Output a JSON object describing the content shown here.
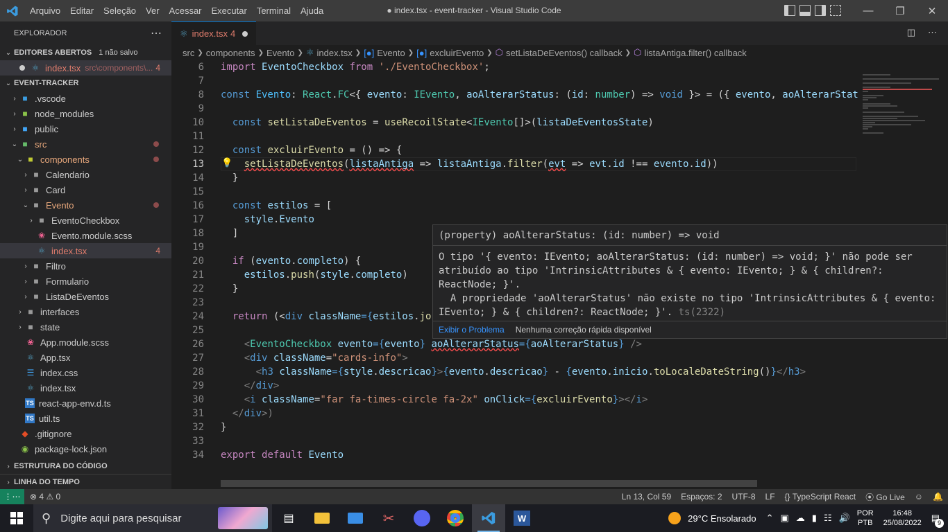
{
  "window": {
    "title": "● index.tsx - event-tracker - Visual Studio Code",
    "menu": [
      "Arquivo",
      "Editar",
      "Seleção",
      "Ver",
      "Acessar",
      "Executar",
      "Terminal",
      "Ajuda"
    ]
  },
  "sidebar": {
    "title": "EXPLORADOR",
    "open_editors": {
      "label": "EDITORES ABERTOS",
      "unsaved": "1 não salvo",
      "file": "index.tsx",
      "path": "src\\components\\...",
      "count": "4"
    },
    "project": "EVENT-TRACKER",
    "tree": [
      {
        "label": ".vscode",
        "depth": 1,
        "kind": "folder",
        "icon": "vscode-folder-icon",
        "chev": "›"
      },
      {
        "label": "node_modules",
        "depth": 1,
        "kind": "folder",
        "icon": "node-folder-icon",
        "chev": "›"
      },
      {
        "label": "public",
        "depth": 1,
        "kind": "folder",
        "icon": "public-folder-icon",
        "chev": "›"
      },
      {
        "label": "src",
        "depth": 1,
        "kind": "folder",
        "icon": "src-folder-icon",
        "chev": "⌄",
        "error": true,
        "dot": true
      },
      {
        "label": "components",
        "depth": 2,
        "kind": "folder",
        "icon": "components-folder-icon",
        "chev": "⌄",
        "error": true,
        "dot": true
      },
      {
        "label": "Calendario",
        "depth": 3,
        "kind": "folder",
        "icon": "folder-icon",
        "chev": "›"
      },
      {
        "label": "Card",
        "depth": 3,
        "kind": "folder",
        "icon": "folder-icon",
        "chev": "›"
      },
      {
        "label": "Evento",
        "depth": 3,
        "kind": "folder",
        "icon": "folder-open-icon",
        "chev": "⌄",
        "error": true,
        "dot": true
      },
      {
        "label": "EventoCheckbox",
        "depth": 4,
        "kind": "folder",
        "icon": "folder-icon",
        "chev": "›"
      },
      {
        "label": "Evento.module.scss",
        "depth": 4,
        "kind": "file",
        "icon": "scss-icon"
      },
      {
        "label": "index.tsx",
        "depth": 4,
        "kind": "file",
        "icon": "react-icon",
        "error": true,
        "selected": true,
        "count": "4"
      },
      {
        "label": "Filtro",
        "depth": 3,
        "kind": "folder",
        "icon": "folder-icon",
        "chev": "›"
      },
      {
        "label": "Formulario",
        "depth": 3,
        "kind": "folder",
        "icon": "folder-icon",
        "chev": "›"
      },
      {
        "label": "ListaDeEventos",
        "depth": 3,
        "kind": "folder",
        "icon": "folder-icon",
        "chev": "›"
      },
      {
        "label": "interfaces",
        "depth": 2,
        "kind": "folder",
        "icon": "folder-icon",
        "chev": "›"
      },
      {
        "label": "state",
        "depth": 2,
        "kind": "folder",
        "icon": "folder-icon",
        "chev": "›"
      },
      {
        "label": "App.module.scss",
        "depth": 2,
        "kind": "file",
        "icon": "scss-icon"
      },
      {
        "label": "App.tsx",
        "depth": 2,
        "kind": "file",
        "icon": "react-icon"
      },
      {
        "label": "index.css",
        "depth": 2,
        "kind": "file",
        "icon": "css-icon"
      },
      {
        "label": "index.tsx",
        "depth": 2,
        "kind": "file",
        "icon": "react-icon"
      },
      {
        "label": "react-app-env.d.ts",
        "depth": 2,
        "kind": "file",
        "icon": "ts-icon"
      },
      {
        "label": "util.ts",
        "depth": 2,
        "kind": "file",
        "icon": "ts-icon"
      },
      {
        "label": ".gitignore",
        "depth": 1,
        "kind": "file",
        "icon": "git-icon"
      },
      {
        "label": "package-lock.json",
        "depth": 1,
        "kind": "file",
        "icon": "json-icon"
      }
    ],
    "outline": "ESTRUTURA DO CÓDIGO",
    "timeline": "LINHA DO TEMPO"
  },
  "tab": {
    "label": "index.tsx",
    "problems": "4"
  },
  "breadcrumb": [
    "src",
    "components",
    "Evento",
    "index.tsx",
    "Evento",
    "excluirEvento",
    "setListaDeEventos() callback",
    "listaAntiga.filter() callback"
  ],
  "code": {
    "current_line": 13,
    "lines": [
      {
        "n": 6,
        "t": [
          [
            "import ",
            "kw"
          ],
          [
            "EventoCheckbox ",
            "vr"
          ],
          [
            "from ",
            "kw"
          ],
          [
            "'./EventoCheckbox'",
            "st"
          ],
          [
            ";",
            "pu"
          ]
        ]
      },
      {
        "n": 7,
        "t": []
      },
      {
        "n": 8,
        "t": [
          [
            "const ",
            "kb"
          ],
          [
            "Evento",
            "cy"
          ],
          [
            ": ",
            "pu"
          ],
          [
            "React",
            "ty"
          ],
          [
            ".",
            "pu"
          ],
          [
            "FC",
            "ty"
          ],
          [
            "<{ ",
            "pu"
          ],
          [
            "evento",
            "vr"
          ],
          [
            ": ",
            "pu"
          ],
          [
            "IEvento",
            "ty"
          ],
          [
            ", ",
            "pu"
          ],
          [
            "aoAlterarStatus",
            "vr"
          ],
          [
            ": (",
            "pu"
          ],
          [
            "id",
            "vr"
          ],
          [
            ": ",
            "pu"
          ],
          [
            "number",
            "ty"
          ],
          [
            ") => ",
            "pu"
          ],
          [
            "void",
            "kb"
          ],
          [
            " }> = ({ ",
            "pu"
          ],
          [
            "evento",
            "vr"
          ],
          [
            ", ",
            "pu"
          ],
          [
            "aoAlterarStat",
            "vr"
          ]
        ]
      },
      {
        "n": 9,
        "t": []
      },
      {
        "n": 10,
        "t": [
          [
            "  const ",
            "kb"
          ],
          [
            "setListaDeEventos",
            "fn"
          ],
          [
            " = ",
            "pu"
          ],
          [
            "useRecoilState",
            "fn"
          ],
          [
            "<",
            "pu"
          ],
          [
            "IEvento",
            "ty"
          ],
          [
            "[]",
            "pu"
          ],
          [
            ">(",
            "pu"
          ],
          [
            "listaDeEventosState",
            "vr"
          ],
          [
            ")",
            "pu"
          ]
        ]
      },
      {
        "n": 11,
        "t": []
      },
      {
        "n": 12,
        "t": [
          [
            "  const ",
            "kb"
          ],
          [
            "excluirEvento",
            "fn"
          ],
          [
            " = () => {",
            "pu"
          ]
        ]
      },
      {
        "n": 13,
        "t": [
          [
            "    ",
            "pu"
          ],
          [
            "setListaDeEventos",
            "fn",
            "sq"
          ],
          [
            "(",
            "pu"
          ],
          [
            "listaAntiga",
            "vr",
            "sq"
          ],
          [
            " => ",
            "pu"
          ],
          [
            "listaAntiga",
            "vr"
          ],
          [
            ".",
            "pu"
          ],
          [
            "filter",
            "fn"
          ],
          [
            "(",
            "pu"
          ],
          [
            "evt",
            "vr",
            "sq"
          ],
          [
            " => ",
            "pu"
          ],
          [
            "evt",
            "vr"
          ],
          [
            ".",
            "pu"
          ],
          [
            "id",
            "vr"
          ],
          [
            " !== ",
            "pu"
          ],
          [
            "evento",
            "vr"
          ],
          [
            ".",
            "pu"
          ],
          [
            "id",
            "vr"
          ],
          [
            "))",
            "pu"
          ]
        ]
      },
      {
        "n": 14,
        "t": [
          [
            "  }",
            "pu"
          ]
        ]
      },
      {
        "n": 15,
        "t": []
      },
      {
        "n": 16,
        "t": [
          [
            "  const ",
            "kb"
          ],
          [
            "estilos",
            "vr"
          ],
          [
            " = [",
            "pu"
          ]
        ]
      },
      {
        "n": 17,
        "t": [
          [
            "    ",
            "pu"
          ],
          [
            "style",
            "vr"
          ],
          [
            ".",
            "pu"
          ],
          [
            "Evento",
            "vr"
          ]
        ]
      },
      {
        "n": 18,
        "t": [
          [
            "  ]",
            "pu"
          ]
        ]
      },
      {
        "n": 19,
        "t": []
      },
      {
        "n": 20,
        "t": [
          [
            "  if ",
            "kw"
          ],
          [
            "(",
            "pu"
          ],
          [
            "evento",
            "vr"
          ],
          [
            ".",
            "pu"
          ],
          [
            "completo",
            "vr"
          ],
          [
            ") {",
            "pu"
          ]
        ]
      },
      {
        "n": 21,
        "t": [
          [
            "    ",
            "pu"
          ],
          [
            "estilos",
            "vr"
          ],
          [
            ".",
            "pu"
          ],
          [
            "push",
            "fn"
          ],
          [
            "(",
            "pu"
          ],
          [
            "style",
            "vr"
          ],
          [
            ".",
            "pu"
          ],
          [
            "completo",
            "vr"
          ],
          [
            ")",
            "pu"
          ]
        ]
      },
      {
        "n": 22,
        "t": [
          [
            "  }",
            "pu"
          ]
        ]
      },
      {
        "n": 23,
        "t": []
      },
      {
        "n": 24,
        "t": [
          [
            "  return ",
            "kw"
          ],
          [
            "(<",
            "pu"
          ],
          [
            "div ",
            "kb"
          ],
          [
            "className",
            "vr"
          ],
          [
            "={",
            "kb"
          ],
          [
            "estilos",
            "vr"
          ],
          [
            ".",
            "pu"
          ],
          [
            "jo",
            "fn"
          ]
        ]
      },
      {
        "n": 25,
        "t": []
      },
      {
        "n": 26,
        "t": [
          [
            "    <",
            "gy"
          ],
          [
            "EventoCheckbox ",
            "ty"
          ],
          [
            "evento",
            "vr"
          ],
          [
            "={",
            "kb"
          ],
          [
            "evento",
            "vr"
          ],
          [
            "} ",
            "kb"
          ],
          [
            "aoAlterarStatus",
            "vr",
            "sq"
          ],
          [
            "={",
            "kb"
          ],
          [
            "aoAlterarStatus",
            "vr"
          ],
          [
            "}",
            "kb"
          ],
          [
            " />",
            "gy"
          ]
        ]
      },
      {
        "n": 27,
        "t": [
          [
            "    <",
            "gy"
          ],
          [
            "div ",
            "kb"
          ],
          [
            "className",
            "vr"
          ],
          [
            "=",
            "pu"
          ],
          [
            "\"cards-info\"",
            "st"
          ],
          [
            ">",
            "gy"
          ]
        ]
      },
      {
        "n": 28,
        "t": [
          [
            "      <",
            "gy"
          ],
          [
            "h3 ",
            "kb"
          ],
          [
            "className",
            "vr"
          ],
          [
            "={",
            "kb"
          ],
          [
            "style",
            "vr"
          ],
          [
            ".",
            "pu"
          ],
          [
            "descricao",
            "vr"
          ],
          [
            "}",
            "kb"
          ],
          [
            ">",
            "gy"
          ],
          [
            "{",
            "kb"
          ],
          [
            "evento",
            "vr"
          ],
          [
            ".",
            "pu"
          ],
          [
            "descricao",
            "vr"
          ],
          [
            "}",
            "kb"
          ],
          [
            " - ",
            "pu"
          ],
          [
            "{",
            "kb"
          ],
          [
            "evento",
            "vr"
          ],
          [
            ".",
            "pu"
          ],
          [
            "inicio",
            "vr"
          ],
          [
            ".",
            "pu"
          ],
          [
            "toLocaleDateString",
            "fn"
          ],
          [
            "()",
            "pu"
          ],
          [
            "}",
            "kb"
          ],
          [
            "</",
            "gy"
          ],
          [
            "h3",
            "kb"
          ],
          [
            ">",
            "gy"
          ]
        ]
      },
      {
        "n": 29,
        "t": [
          [
            "    </",
            "gy"
          ],
          [
            "div",
            "kb"
          ],
          [
            ">",
            "gy"
          ]
        ]
      },
      {
        "n": 30,
        "t": [
          [
            "    <",
            "gy"
          ],
          [
            "i ",
            "kb"
          ],
          [
            "className",
            "vr"
          ],
          [
            "=",
            "pu"
          ],
          [
            "\"far fa-times-circle fa-2x\"",
            "st"
          ],
          [
            " onClick",
            "vr"
          ],
          [
            "={",
            "kb"
          ],
          [
            "excluirEvento",
            "fn"
          ],
          [
            "}",
            "kb"
          ],
          [
            "></",
            "gy"
          ],
          [
            "i",
            "kb"
          ],
          [
            ">",
            "gy"
          ]
        ]
      },
      {
        "n": 31,
        "t": [
          [
            "  </",
            "gy"
          ],
          [
            "div",
            "kb"
          ],
          [
            ">)",
            "gy"
          ]
        ]
      },
      {
        "n": 32,
        "t": [
          [
            "}",
            "pu"
          ]
        ]
      },
      {
        "n": 33,
        "t": []
      },
      {
        "n": 34,
        "t": [
          [
            "export ",
            "kw"
          ],
          [
            "default ",
            "kw"
          ],
          [
            "Evento",
            "vr"
          ]
        ]
      }
    ]
  },
  "hover": {
    "signature": "(property) aoAlterarStatus: (id: number) => void",
    "message": "O tipo '{ evento: IEvento; aoAlterarStatus: (id: number) => void; }' não pode ser\natribuído ao tipo 'IntrinsicAttributes & { evento: IEvento; } & { children?:\nReactNode; }'.\n  A propriedade 'aoAlterarStatus' não existe no tipo 'IntrinsicAttributes & { evento:\nIEvento; } & { children?: ReactNode; }'.",
    "code": "ts(2322)",
    "link": "Exibir o Problema",
    "note": "Nenhuma correção rápida disponível"
  },
  "status": {
    "errors": "4",
    "warnings": "0",
    "position": "Ln 13, Col 59",
    "spaces": "Espaços: 2",
    "encoding": "UTF-8",
    "eol": "LF",
    "language": "TypeScript React",
    "golive": "Go Live"
  },
  "taskbar": {
    "search": "Digite aqui para pesquisar",
    "weather": "29°C  Ensolarado",
    "lang": "POR",
    "lang2": "PTB",
    "time": "16:48",
    "date": "25/08/2022",
    "notif": "9"
  }
}
